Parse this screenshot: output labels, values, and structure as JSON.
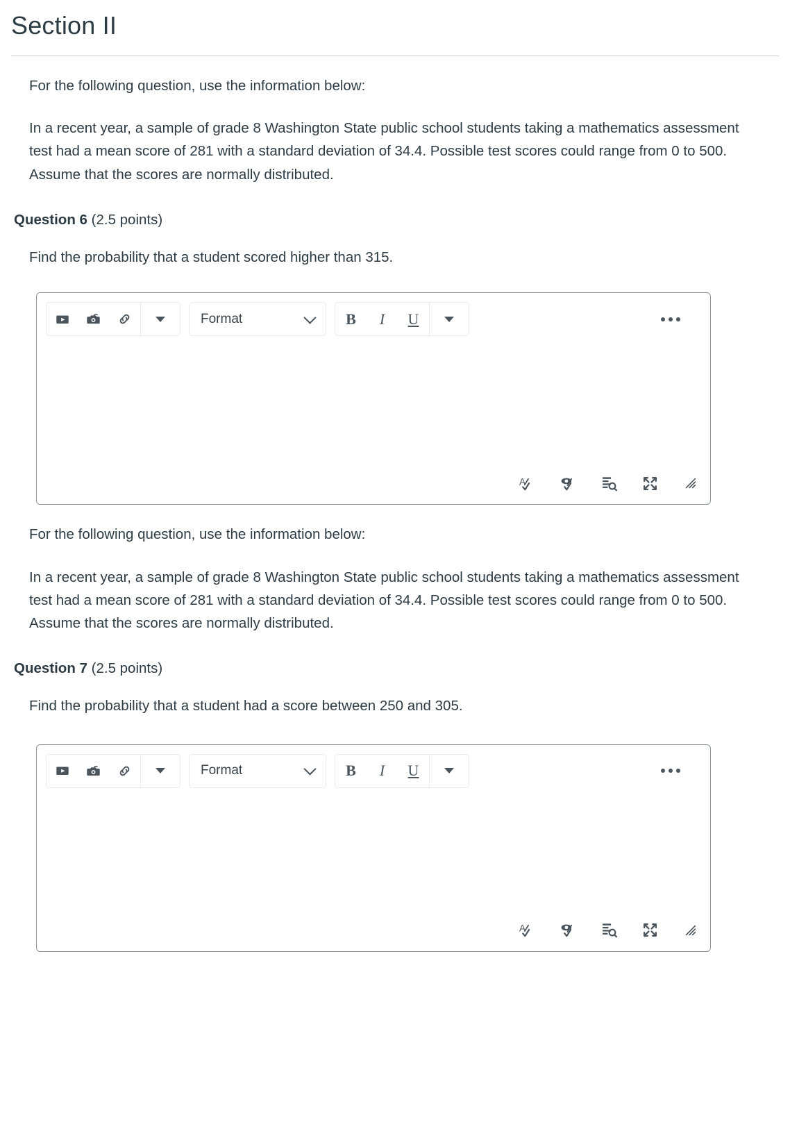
{
  "page": {
    "title": "Section II"
  },
  "intro": {
    "lead": "For the following question, use the information below:",
    "body": "In a recent year, a sample of grade 8 Washington State public school students taking a mathematics assessment test had a mean score of 281 with a standard deviation of 34.4. Possible test scores could range from 0 to 500.  Assume that the scores are normally distributed."
  },
  "questions": [
    {
      "number": "Question 6",
      "points": "(2.5 points)",
      "prompt": "Find the probability that a student scored higher than 315."
    },
    {
      "number": "Question 7",
      "points": "(2.5 points)",
      "prompt": "Find the probability that a student had a score between 250 and 305."
    }
  ],
  "editor": {
    "format_label": "Format",
    "bold_label": "B",
    "italic_label": "I",
    "underline_label": "U",
    "icons": {
      "media": "media-play-icon",
      "camera": "camera-icon",
      "link": "link-icon",
      "insert_caret": "chevron-down-icon",
      "format_caret": "chevron-down-icon",
      "text_caret": "chevron-down-icon",
      "more": "more-options-icon",
      "spellcheck": "spellcheck-icon",
      "accessibility": "accessibility-checker-icon",
      "wordcount": "word-count-icon",
      "fullscreen": "fullscreen-icon",
      "resize": "resize-handle-icon"
    },
    "content": ""
  },
  "colors": {
    "text": "#2d3b45",
    "rule": "#c7cdd1",
    "editor_border": "#8b959e",
    "group_border": "#e8eaec",
    "icon": "#4a545d"
  }
}
